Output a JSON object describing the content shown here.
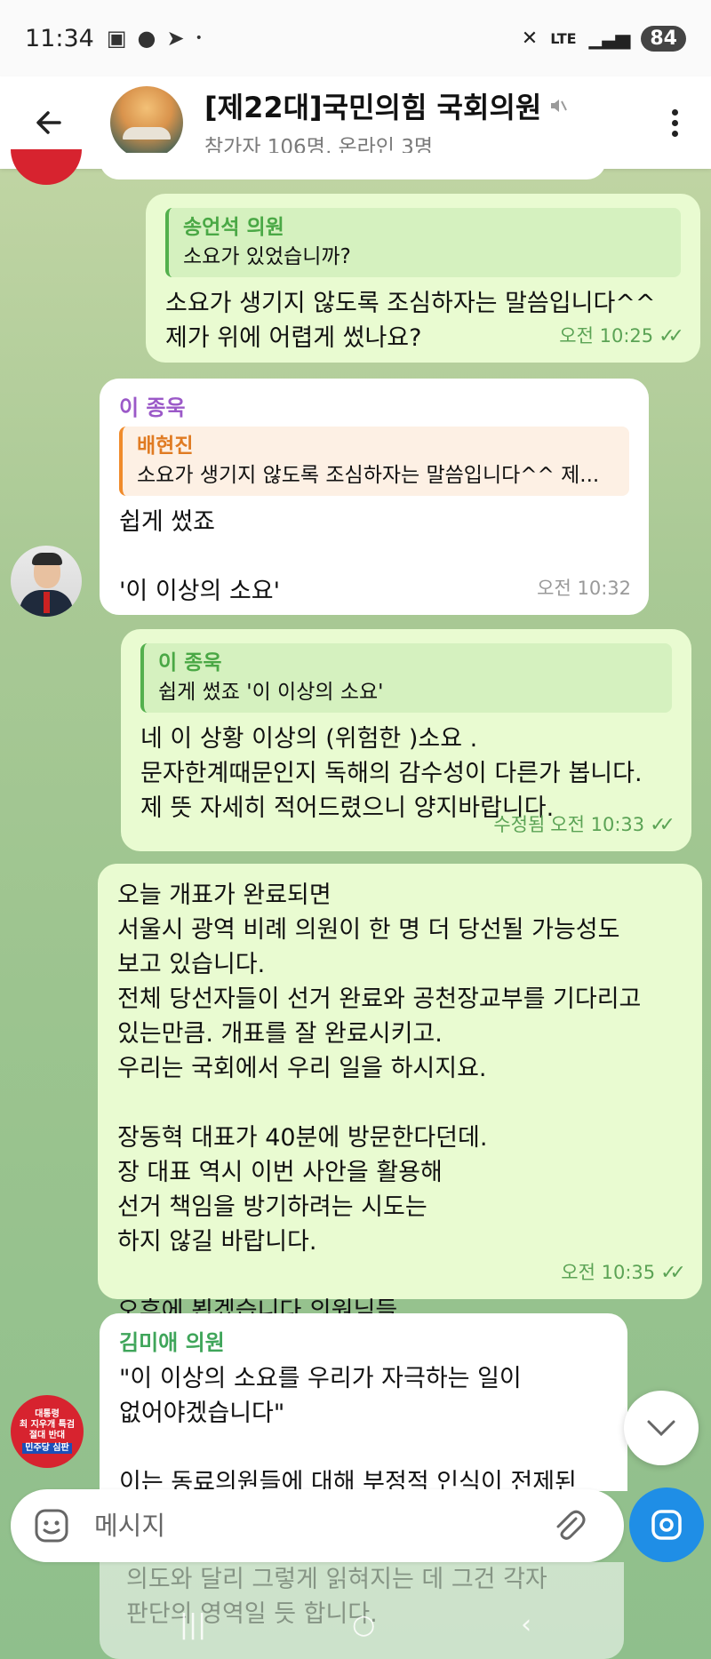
{
  "status_bar": {
    "time": "11:34",
    "network": "LTE",
    "battery": "84"
  },
  "header": {
    "title": "[제22대]국민의힘 국회의원",
    "subtitle": "참가자 106명, 온라인 3명",
    "muted_icon": "mute-icon"
  },
  "messages": [
    {
      "direction": "out",
      "quote_name": "송언석 의원",
      "quote_text": "소요가 있었습니까?",
      "text": "소요가 생기지 않도록 조심하자는 말씀입니다^^\n제가 위에 어렵게 썼나요?",
      "time": "오전 10:25"
    },
    {
      "direction": "in",
      "sender": "이 종욱",
      "quote_name": "배현진",
      "quote_text": "소요가 생기지 않도록 조심하자는 말씀입니다^^  제...",
      "text": "쉽게 썼죠\n\n'이 이상의 소요'",
      "time": "오전 10:32"
    },
    {
      "direction": "out",
      "quote_name": "이 종욱",
      "quote_text": "쉽게 썼죠  '이 이상의 소요'",
      "text": "네 이 상황 이상의 (위험한 )소요 .\n문자한계때문인지 독해의 감수성이 다른가 봅니다.\n제 뜻 자세히 적어드렸으니 양지바랍니다.",
      "edited": "수정됨",
      "time": "오전 10:33"
    },
    {
      "direction": "out",
      "text": "오늘 개표가 완료되면\n서울시 광역 비례 의원이 한 명 더 당선될 가능성도\n보고 있습니다.\n전체 당선자들이 선거 완료와 공천장교부를 기다리고\n있는만큼. 개표를 잘  완료시키고.\n우리는 국회에서 우리 일을 하시지요.\n\n장동혁 대표가 40분에 방문한다던데.\n장 대표 역시 이번 사안을 활용해\n선거 책임을 방기하려는 시도는\n하지 않길 바랍니다.\n\n오후에 뵙겠습니다 의원님들",
      "time": "오전 10:35"
    },
    {
      "direction": "in",
      "sender": "김미애 의원",
      "text": "\"이 이상의 소요를 우리가 자극하는 일이\n없어야겠습니다\"\n\n이는 동료의원들에 대해 부정적 인식이 전제된"
    }
  ],
  "red_avatar": {
    "line1": "대통령",
    "line2": "최 지우개 특검",
    "line3": "절대 반대",
    "line4": "민주당 심판"
  },
  "faded_text": "의도와 달리 그렇게 읽혀지는 데 그건 각자\n판단의 영역일 듯 합니다.",
  "input": {
    "placeholder": "메시지"
  },
  "colors": {
    "outgoing_bubble": "#e9fbd1",
    "incoming_bubble": "#ffffff",
    "sender_purple": "#9b59c8",
    "sender_green": "#4aa845",
    "quote_orange": "#e07b22",
    "accent_blue": "#1f8ee6"
  }
}
